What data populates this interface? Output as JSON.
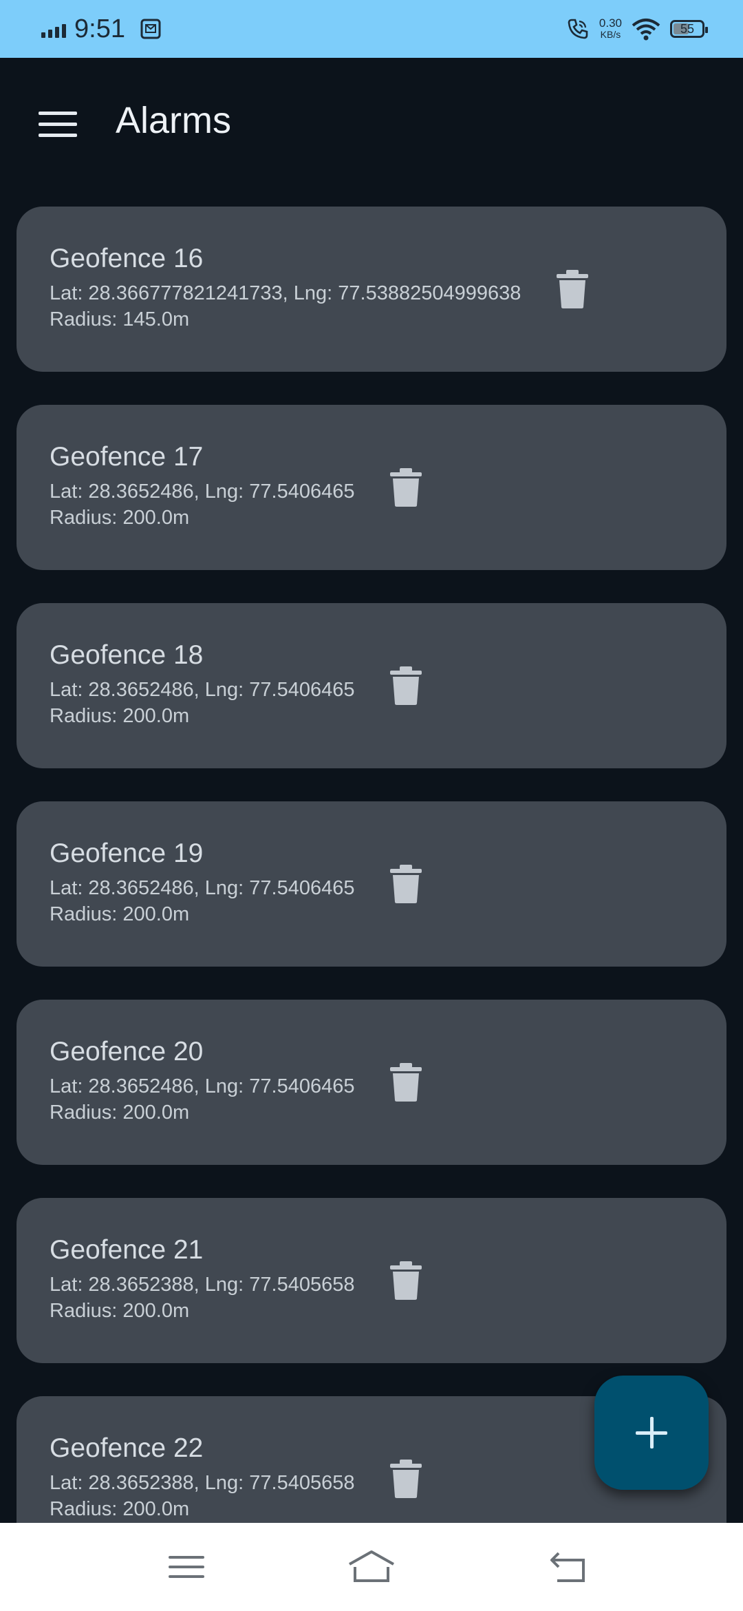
{
  "status_bar": {
    "time": "9:51",
    "net_speed_value": "0.30",
    "net_speed_unit": "KB/s",
    "battery_level": "55",
    "battery_fraction": 0.55
  },
  "app_bar": {
    "title": "Alarms",
    "menu_icon": "hamburger-menu-icon"
  },
  "geofences": [
    {
      "name": "Geofence 16",
      "coords": "Lat: 28.366777821241733, Lng: 77.53882504999638",
      "radius": "Radius: 145.0m"
    },
    {
      "name": "Geofence 17",
      "coords": "Lat: 28.3652486, Lng: 77.5406465",
      "radius": "Radius: 200.0m"
    },
    {
      "name": "Geofence 18",
      "coords": "Lat: 28.3652486, Lng: 77.5406465",
      "radius": "Radius: 200.0m"
    },
    {
      "name": "Geofence 19",
      "coords": "Lat: 28.3652486, Lng: 77.5406465",
      "radius": "Radius: 200.0m"
    },
    {
      "name": "Geofence 20",
      "coords": "Lat: 28.3652486, Lng: 77.5406465",
      "radius": "Radius: 200.0m"
    },
    {
      "name": "Geofence 21",
      "coords": "Lat: 28.3652388, Lng: 77.5405658",
      "radius": "Radius: 200.0m"
    },
    {
      "name": "Geofence 22",
      "coords": "Lat: 28.3652388, Lng: 77.5405658",
      "radius": "Radius: 200.0m"
    }
  ],
  "icons": {
    "delete": "trash-icon",
    "fab": "plus-icon",
    "nav": [
      "recents-icon",
      "home-icon",
      "back-icon"
    ]
  },
  "colors": {
    "status_bar": "#7dcdfa",
    "background": "#0c131b",
    "card": "#414851",
    "fab": "#00506e"
  }
}
